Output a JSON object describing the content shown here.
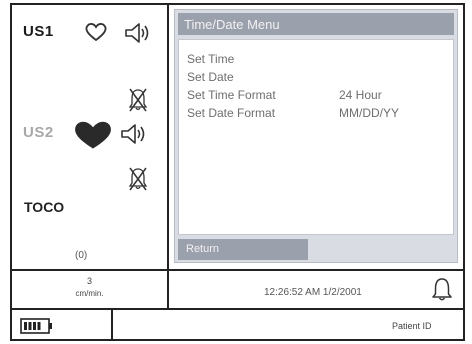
{
  "sensors": {
    "us1": {
      "label": "US1",
      "heart_icon": "heart-outline-icon",
      "speaker_icon": "speaker-icon",
      "alarm_icon": "alarm-off-icon"
    },
    "us2": {
      "label": "US2",
      "heart_icon": "heart-filled-icon",
      "speaker_icon": "speaker-icon",
      "alarm_icon": "alarm-off-icon"
    },
    "toco": {
      "label": "TOCO"
    },
    "toco_zero": "(0)"
  },
  "menu": {
    "title": "Time/Date Menu",
    "items": [
      {
        "label": "Set Time",
        "value": ""
      },
      {
        "label": "Set Date",
        "value": ""
      },
      {
        "label": "Set Time Format",
        "value": "24 Hour"
      },
      {
        "label": "Set Date Format",
        "value": "MM/DD/YY"
      }
    ],
    "return_label": "Return"
  },
  "status": {
    "speed_value": "3",
    "speed_unit": "cm/min.",
    "datetime": "12:26:52 AM  1/2/2001",
    "bell_icon": "bell-icon",
    "battery_icon": "battery-icon",
    "patient_id_label": "Patient ID"
  },
  "colors": {
    "menu_title_bg": "#9ba0ad",
    "menu_panel_bg": "#d9dce3",
    "frame": "#222222"
  }
}
